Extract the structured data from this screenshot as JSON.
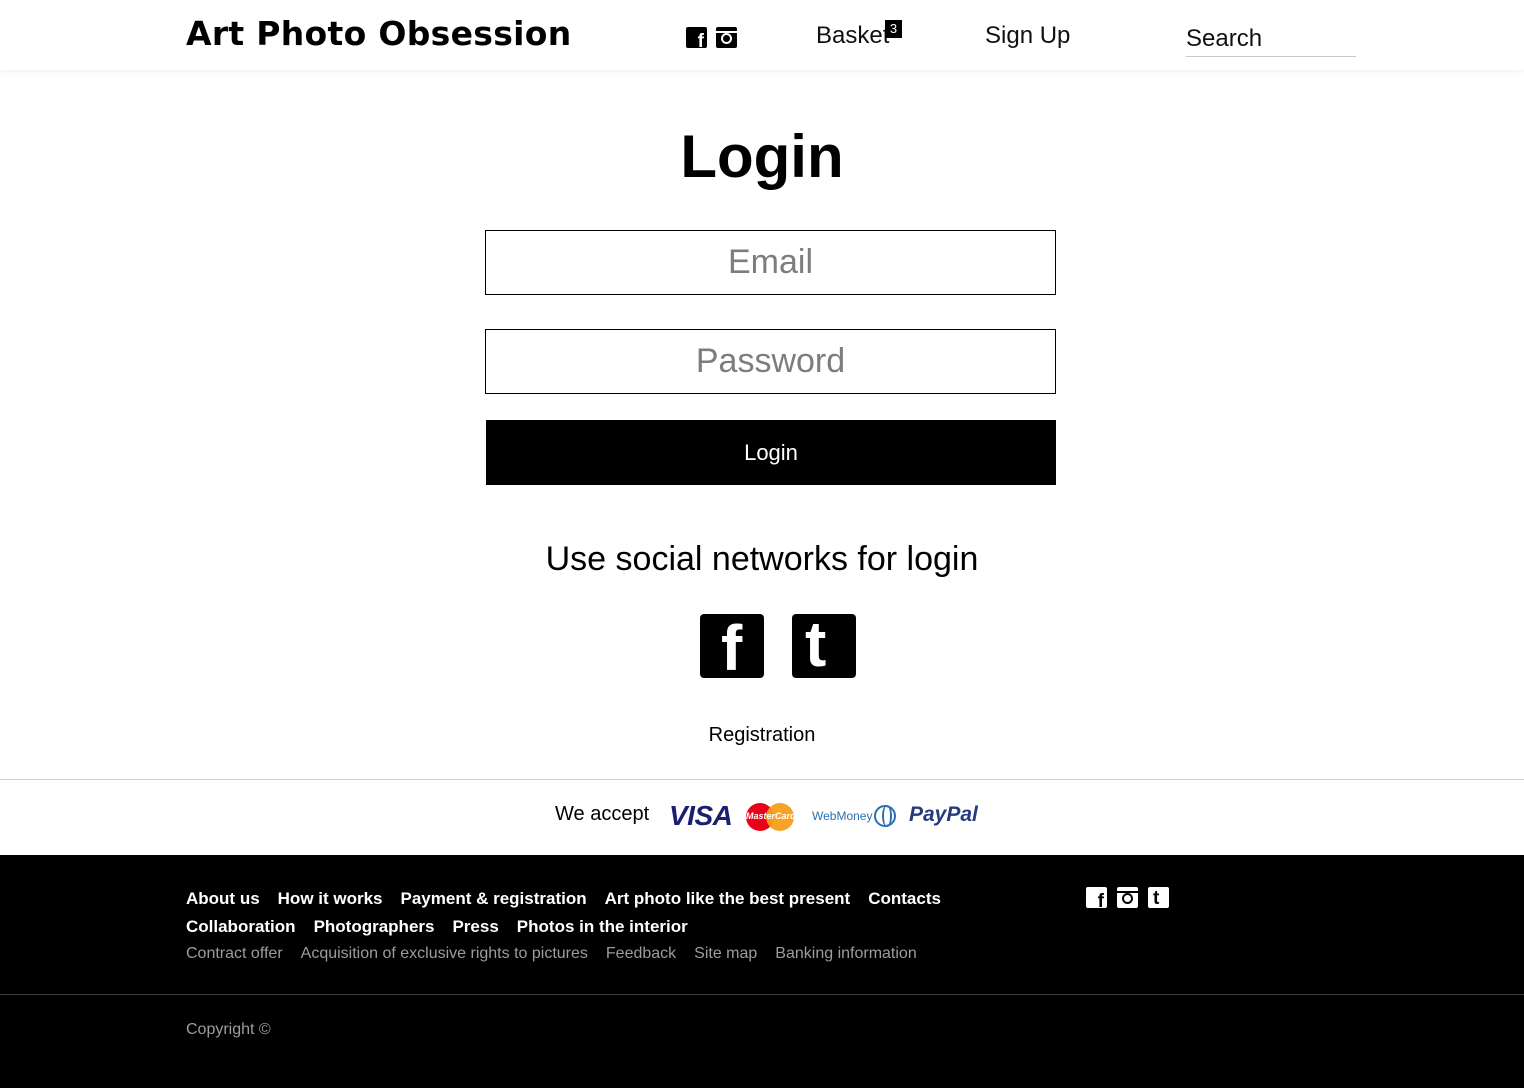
{
  "header": {
    "logo": "Art Photo Obsession",
    "social": [
      "facebook-icon",
      "instagram-icon"
    ],
    "basket_label": "Basket",
    "basket_count": "3",
    "signup_label": "Sign Up",
    "search_placeholder": "Search"
  },
  "main": {
    "title": "Login",
    "email_placeholder": "Email",
    "password_placeholder": "Password",
    "login_button": "Login",
    "social_title": "Use social networks for login",
    "social": [
      "facebook-icon",
      "tumblr-icon"
    ],
    "registration": "Registration"
  },
  "payment": {
    "label": "We accept",
    "methods": [
      "VISA",
      "MasterCard",
      "WebMoney",
      "PayPal"
    ]
  },
  "footer": {
    "row1": [
      "About us",
      "How it works",
      "Payment & registration",
      "Art photo like the best present",
      "Contacts"
    ],
    "row2": [
      "Collaboration",
      "Photographers",
      "Press",
      "Photos in the interior"
    ],
    "row3": [
      "Contract offer",
      "Acquisition of exclusive rights to pictures",
      "Feedback",
      "Site map",
      "Banking information"
    ],
    "social": [
      "facebook-icon",
      "instagram-icon",
      "tumblr-icon"
    ],
    "copyright": "Copyright ©"
  },
  "colors": {
    "primary": "#000000",
    "background": "#ffffff",
    "placeholder": "#7d7d7d",
    "footer_muted": "#9c9c9c",
    "visa": "#1a1f71",
    "paypal": "#253b80",
    "webmoney": "#2c6fb0"
  }
}
